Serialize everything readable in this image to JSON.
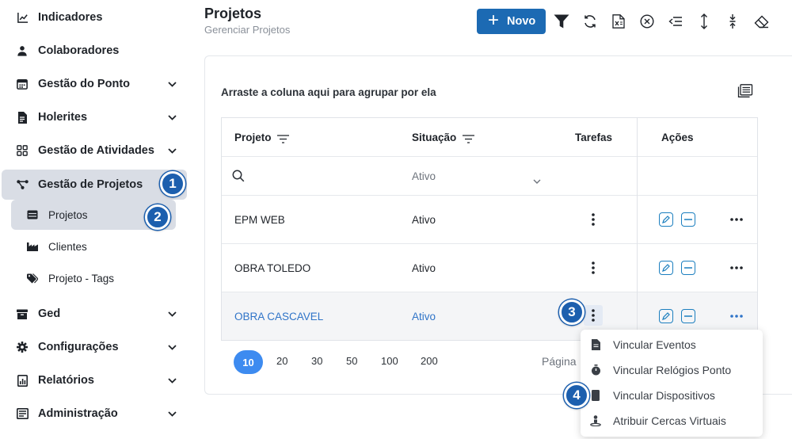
{
  "sidebar": {
    "items": [
      {
        "label": "Indicadores",
        "icon": "chart-line-icon"
      },
      {
        "label": "Colaboradores",
        "icon": "user-icon"
      },
      {
        "label": "Gestão do Ponto",
        "icon": "calendar-icon"
      },
      {
        "label": "Holerites",
        "icon": "document-icon"
      },
      {
        "label": "Gestão de Atividades",
        "icon": "grid-icon"
      },
      {
        "label": "Gestão de Projetos",
        "icon": "share-nodes-icon"
      },
      {
        "label": "Ged",
        "icon": "archive-icon"
      },
      {
        "label": "Configurações",
        "icon": "gear-icon"
      },
      {
        "label": "Relatórios",
        "icon": "report-icon"
      },
      {
        "label": "Administração",
        "icon": "admin-list-icon"
      }
    ],
    "sub_items": [
      {
        "label": "Projetos",
        "icon": "card-icon"
      },
      {
        "label": "Clientes",
        "icon": "factory-icon"
      },
      {
        "label": "Projeto - Tags",
        "icon": "tag-icon"
      }
    ]
  },
  "badges": [
    "1",
    "2",
    "3",
    "4"
  ],
  "header": {
    "title": "Projetos",
    "subtitle": "Gerenciar Projetos",
    "new_button": "Novo",
    "new_button_icon": "+"
  },
  "toolbar_icons": [
    "filter-icon",
    "refresh-icon",
    "export-excel-icon",
    "clear-filter-icon",
    "collapse-icon",
    "expand-vertical-icon",
    "compress-vertical-icon",
    "eraser-icon"
  ],
  "grid": {
    "group_hint": "Arraste a coluna aqui para agrupar por ela",
    "columns": {
      "projeto": "Projeto",
      "situacao": "Situação",
      "tarefas": "Tarefas",
      "acoes": "Ações"
    },
    "filter": {
      "situacao_value": "Ativo"
    },
    "rows": [
      {
        "projeto": "EPM WEB",
        "situacao": "Ativo"
      },
      {
        "projeto": "OBRA TOLEDO",
        "situacao": "Ativo"
      },
      {
        "projeto": "OBRA CASCAVEL",
        "situacao": "Ativo"
      }
    ]
  },
  "pager": {
    "sizes": [
      "10",
      "20",
      "30",
      "50",
      "100",
      "200"
    ],
    "selected": "10",
    "page_label": "Página"
  },
  "context_menu": {
    "items": [
      {
        "label": "Vincular Eventos",
        "icon": "file-icon"
      },
      {
        "label": "Vincular Relógios Ponto",
        "icon": "stopwatch-icon"
      },
      {
        "label": "Vincular Dispositivos",
        "icon": "tablet-icon"
      },
      {
        "label": "Atribuir Cercas Virtuais",
        "icon": "location-person-icon"
      }
    ]
  },
  "colors": {
    "primary": "#1c6ab3",
    "badge": "#1c5fae",
    "link": "#2f74c8",
    "active_bg": "#d9dde5",
    "pager_active": "#3d8bf0"
  }
}
